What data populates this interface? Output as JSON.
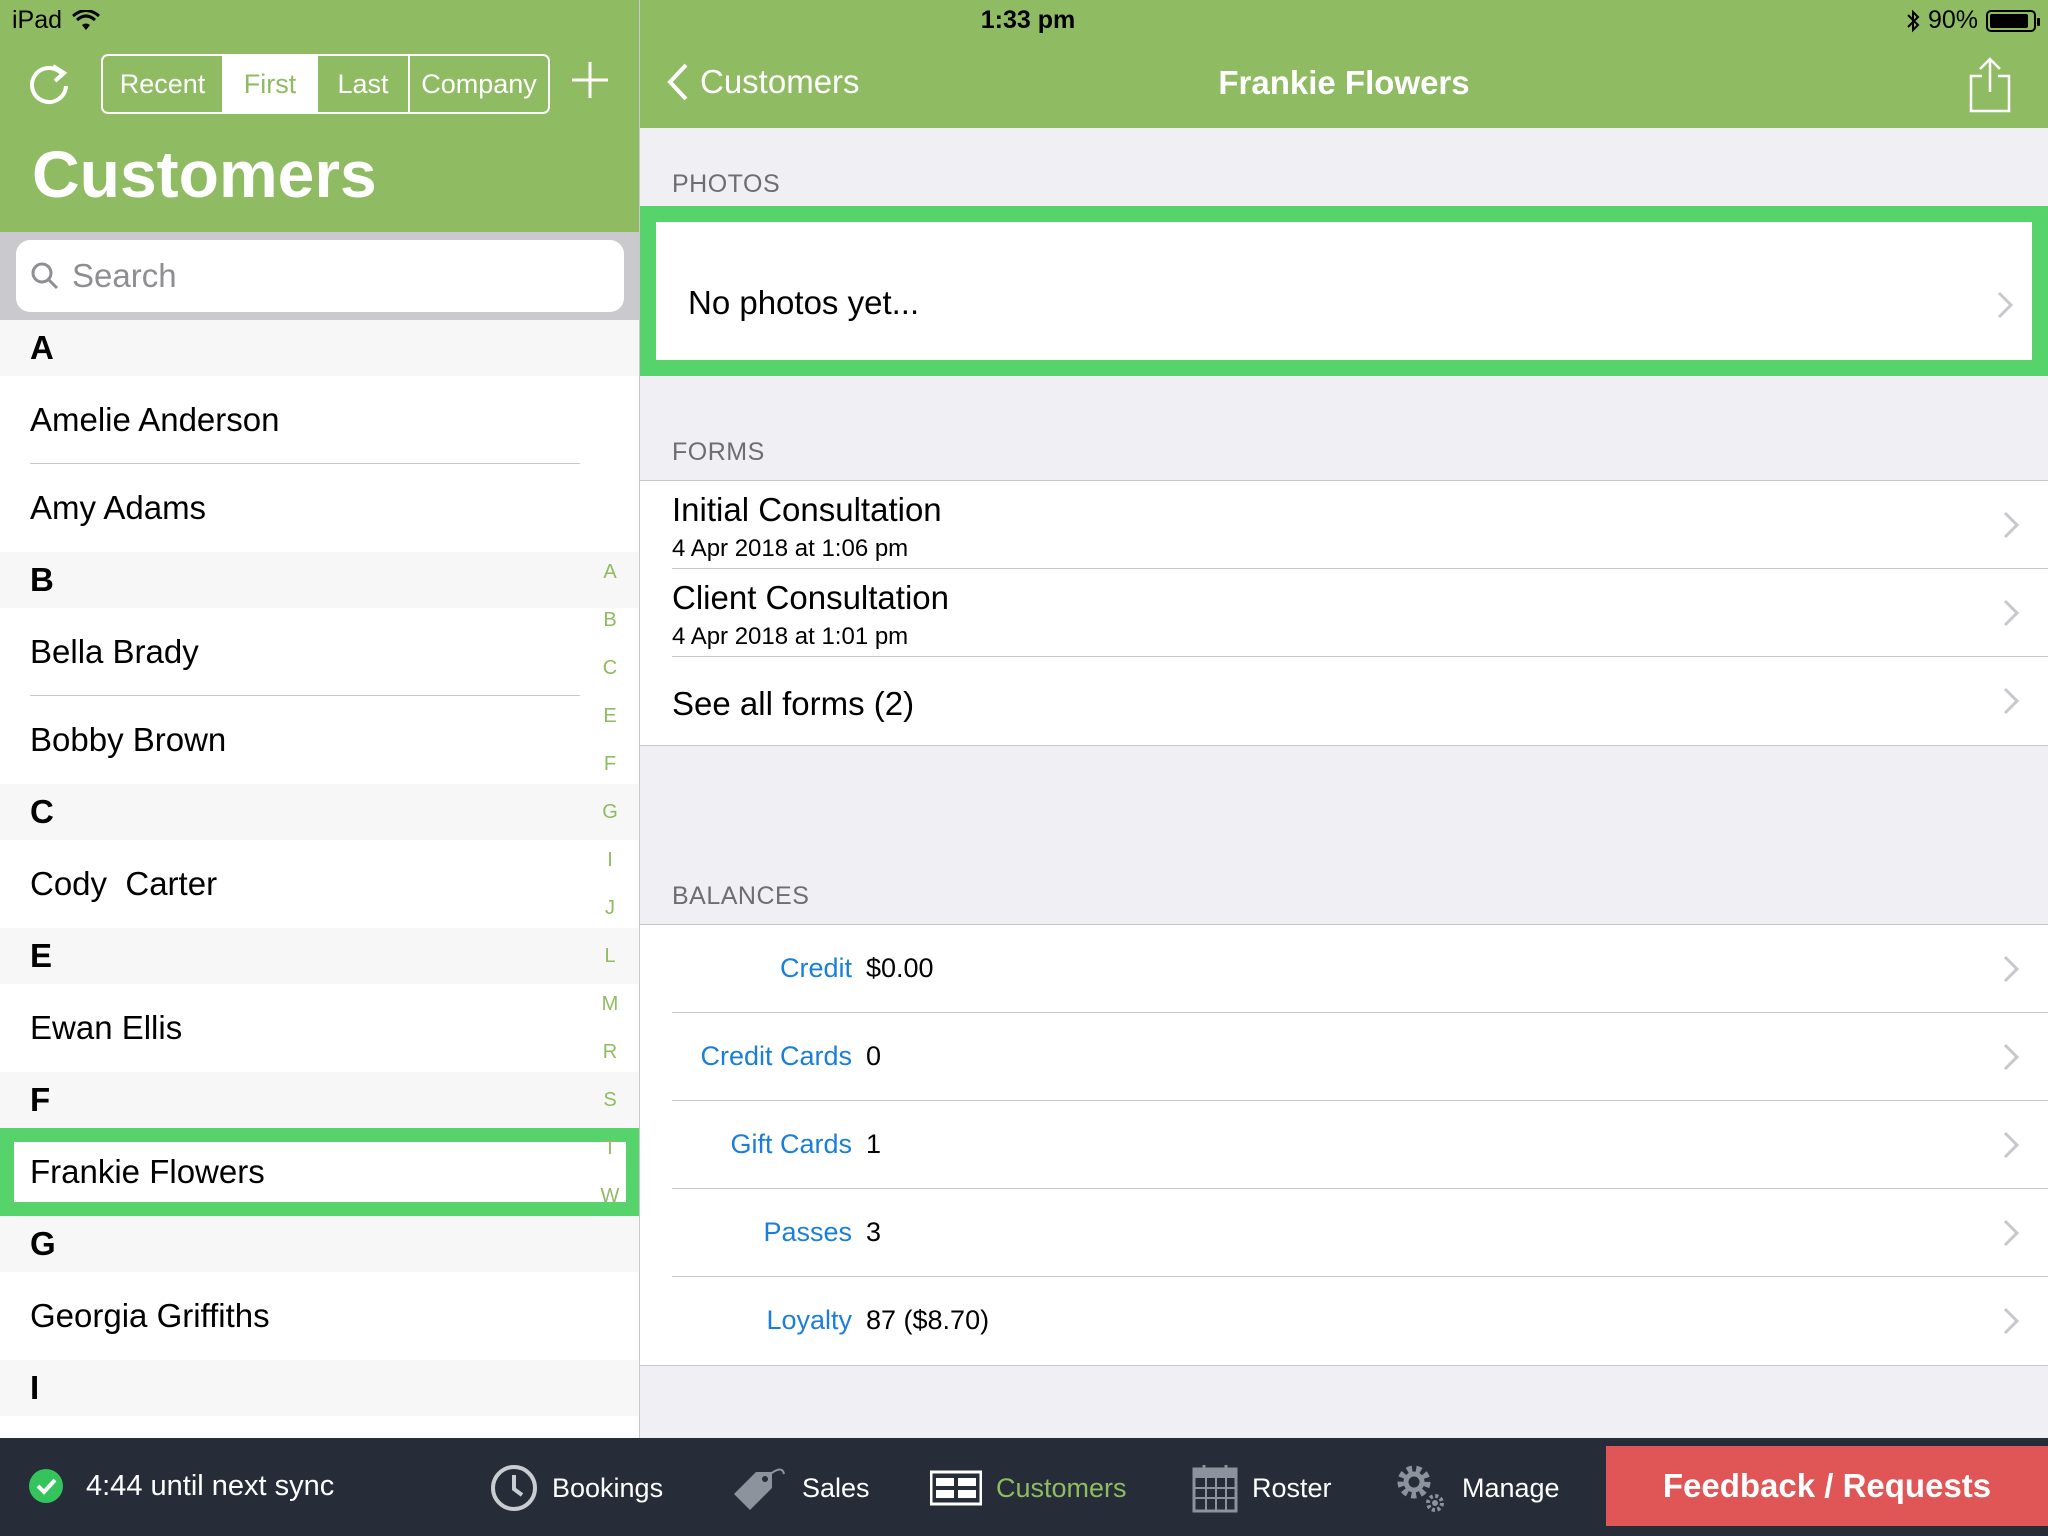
{
  "status_bar": {
    "device": "iPad",
    "time": "1:33 pm",
    "battery": "90%",
    "battery_level": 0.9
  },
  "master": {
    "title": "Customers",
    "segments": [
      {
        "label": "Recent",
        "active": false
      },
      {
        "label": "First",
        "active": true
      },
      {
        "label": "Last",
        "active": false
      },
      {
        "label": "Company",
        "active": false
      }
    ],
    "search_placeholder": "Search",
    "sections": [
      {
        "letter": "A",
        "rows": [
          "Amelie Anderson",
          "Amy Adams"
        ]
      },
      {
        "letter": "B",
        "rows": [
          "Bella Brady",
          "Bobby Brown"
        ]
      },
      {
        "letter": "C",
        "rows": [
          "Cody  Carter"
        ]
      },
      {
        "letter": "E",
        "rows": [
          "Ewan Ellis"
        ]
      },
      {
        "letter": "F",
        "rows": [
          "Frankie Flowers"
        ]
      },
      {
        "letter": "G",
        "rows": [
          "Georgia Griffiths"
        ]
      },
      {
        "letter": "I",
        "rows": []
      }
    ],
    "selected": "Frankie Flowers",
    "index_letters": [
      "A",
      "B",
      "C",
      "E",
      "F",
      "G",
      "I",
      "J",
      "L",
      "M",
      "R",
      "S",
      "T",
      "W"
    ]
  },
  "detail": {
    "back_label": "Customers",
    "title": "Frankie Flowers",
    "photos": {
      "header": "PHOTOS",
      "empty_text": "No photos yet..."
    },
    "forms": {
      "header": "FORMS",
      "items": [
        {
          "title": "Initial Consultation",
          "date": "4 Apr 2018 at 1:06 pm"
        },
        {
          "title": "Client Consultation",
          "date": "4 Apr 2018 at 1:01 pm"
        }
      ],
      "see_all": "See all forms (2)"
    },
    "balances": {
      "header": "BALANCES",
      "items": [
        {
          "key": "Credit",
          "value": "$0.00"
        },
        {
          "key": "Credit Cards",
          "value": "0"
        },
        {
          "key": "Gift Cards",
          "value": "1"
        },
        {
          "key": "Passes",
          "value": "3"
        },
        {
          "key": "Loyalty",
          "value": "87 ($8.70)"
        }
      ]
    }
  },
  "tabbar": {
    "sync_text": "4:44 until next sync",
    "tabs": [
      {
        "label": "Bookings",
        "icon": "clock-icon"
      },
      {
        "label": "Sales",
        "icon": "tag-icon"
      },
      {
        "label": "Customers",
        "icon": "customers-icon"
      },
      {
        "label": "Roster",
        "icon": "calendar-icon"
      },
      {
        "label": "Manage",
        "icon": "gear-icon"
      }
    ],
    "feedback_label": "Feedback / Requests"
  },
  "colors": {
    "accent_green": "#8fbb62",
    "highlight_green": "#57d36b",
    "link_blue": "#1a7fd9",
    "feedback_red": "#e05555",
    "tabbar_bg": "#262d38"
  }
}
